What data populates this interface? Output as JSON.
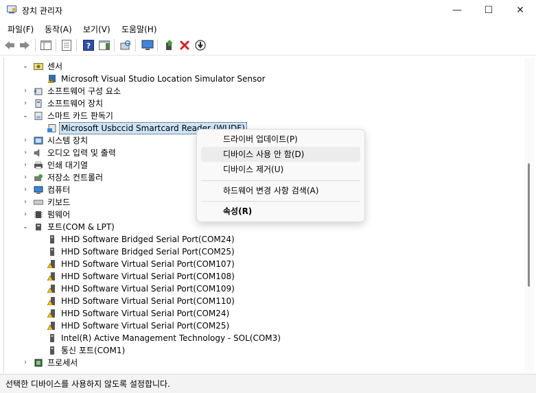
{
  "window": {
    "title": "장치 관리자",
    "minimize": "—",
    "maximize": "☐",
    "close": "✕"
  },
  "menu": [
    "파일(F)",
    "동작(A)",
    "보기(V)",
    "도움말(H)"
  ],
  "tree": [
    {
      "label": "센서",
      "level": 1,
      "expand": "open",
      "icon": "sensor-icon"
    },
    {
      "label": "Microsoft Visual Studio Location Simulator Sensor",
      "level": 2,
      "icon": "warning-device-icon"
    },
    {
      "label": "소프트웨어 구성 요소",
      "level": 1,
      "expand": "closed",
      "icon": "software-component-icon"
    },
    {
      "label": "소프트웨어 장치",
      "level": 1,
      "expand": "closed",
      "icon": "software-device-icon"
    },
    {
      "label": "스마트 카드 판독기",
      "level": 1,
      "expand": "open",
      "icon": "smartcard-reader-icon"
    },
    {
      "label": "Microsoft Usbccid Smartcard Reader (WUDF)",
      "level": 2,
      "icon": "smartcard-device-icon",
      "selected": true
    },
    {
      "label": "시스템 장치",
      "level": 1,
      "expand": "closed",
      "icon": "system-device-icon"
    },
    {
      "label": "오디오 입력 및 출력",
      "level": 1,
      "expand": "closed",
      "icon": "audio-icon"
    },
    {
      "label": "인쇄 대기열",
      "level": 1,
      "expand": "closed",
      "icon": "printer-icon"
    },
    {
      "label": "저장소 컨트롤러",
      "level": 1,
      "expand": "closed",
      "icon": "storage-controller-icon"
    },
    {
      "label": "컴퓨터",
      "level": 1,
      "expand": "closed",
      "icon": "computer-icon"
    },
    {
      "label": "키보드",
      "level": 1,
      "expand": "closed",
      "icon": "keyboard-icon"
    },
    {
      "label": "펌웨어",
      "level": 1,
      "expand": "closed",
      "icon": "firmware-icon"
    },
    {
      "label": "포트(COM & LPT)",
      "level": 1,
      "expand": "open",
      "icon": "port-icon"
    },
    {
      "label": "HHD Software Bridged Serial Port(COM24)",
      "level": 2,
      "icon": "port-device-icon"
    },
    {
      "label": "HHD Software Bridged Serial Port(COM25)",
      "level": 2,
      "icon": "port-device-icon"
    },
    {
      "label": "HHD Software Virtual Serial Port(COM107)",
      "level": 2,
      "icon": "warning-port-icon"
    },
    {
      "label": "HHD Software Virtual Serial Port(COM108)",
      "level": 2,
      "icon": "warning-port-icon"
    },
    {
      "label": "HHD Software Virtual Serial Port(COM109)",
      "level": 2,
      "icon": "warning-port-icon"
    },
    {
      "label": "HHD Software Virtual Serial Port(COM110)",
      "level": 2,
      "icon": "warning-port-icon"
    },
    {
      "label": "HHD Software Virtual Serial Port(COM24)",
      "level": 2,
      "icon": "warning-port-icon"
    },
    {
      "label": "HHD Software Virtual Serial Port(COM25)",
      "level": 2,
      "icon": "warning-port-icon"
    },
    {
      "label": "Intel(R) Active Management Technology - SOL(COM3)",
      "level": 2,
      "icon": "port-device-icon"
    },
    {
      "label": "통신 포트(COM1)",
      "level": 2,
      "icon": "port-device-icon"
    },
    {
      "label": "프로세서",
      "level": 1,
      "expand": "closed",
      "icon": "processor-icon"
    }
  ],
  "context_menu": [
    {
      "label": "드라이버 업데이트(P)"
    },
    {
      "label": "디바이스 사용 안 함(D)",
      "hover": true
    },
    {
      "label": "디바이스 제거(U)"
    },
    {
      "label": "하드웨어 변경 사항 검색(A)"
    },
    {
      "label": "속성(R)",
      "bold": true
    }
  ],
  "status": "선택한 디바이스를 사용하지 않도록 설정합니다."
}
